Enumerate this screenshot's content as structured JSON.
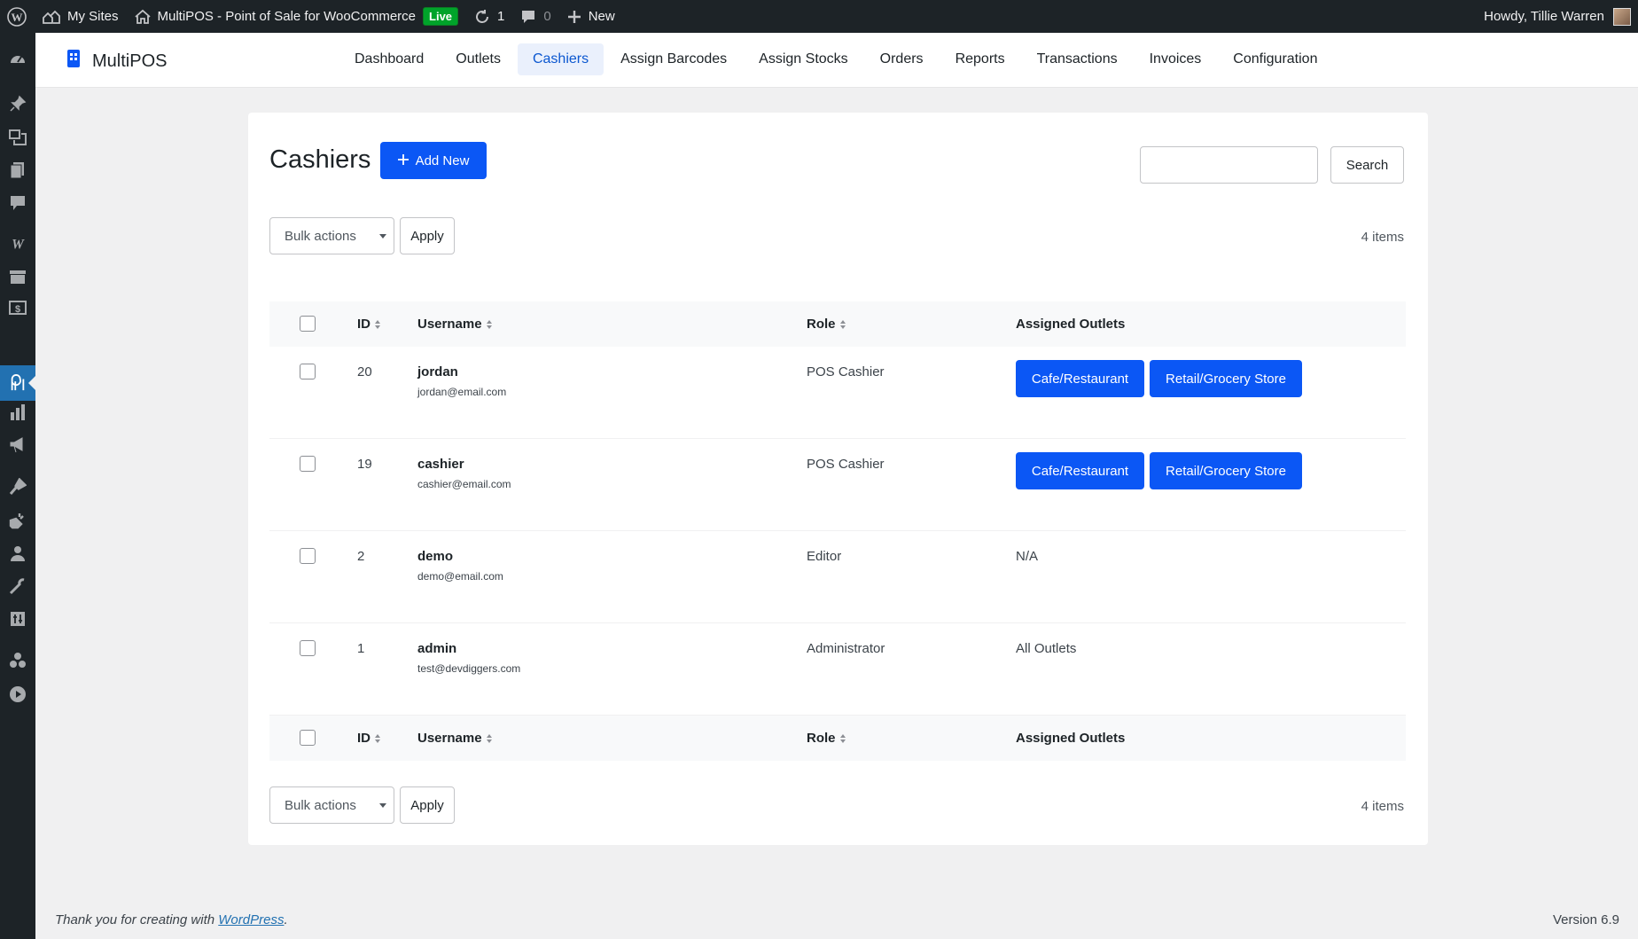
{
  "adminbar": {
    "my_sites": "My Sites",
    "site_name": "MultiPOS - Point of Sale for WooCommerce",
    "live_badge": "Live",
    "updates_count": "1",
    "comments_count": "0",
    "new_label": "New",
    "howdy": "Howdy, Tillie Warren"
  },
  "adminmenu": {
    "icons": [
      "dashboard-icon",
      "pin-icon",
      "media-icon",
      "pages-icon",
      "comments-icon",
      "woocommerce-icon",
      "products-icon",
      "payments-icon",
      "multipos-icon",
      "analytics-icon",
      "marketing-icon",
      "appearance-icon",
      "plugins-icon",
      "users-icon",
      "tools-icon",
      "settings-icon",
      "collaboration-icon",
      "video-icon"
    ]
  },
  "header": {
    "brand": "MultiPOS",
    "nav": [
      "Dashboard",
      "Outlets",
      "Cashiers",
      "Assign Barcodes",
      "Assign Stocks",
      "Orders",
      "Reports",
      "Transactions",
      "Invoices",
      "Configuration"
    ],
    "active_nav": "Cashiers"
  },
  "page": {
    "title": "Cashiers",
    "add_new": "Add New",
    "search_button": "Search",
    "search_value": "",
    "bulk_actions": "Bulk actions",
    "apply": "Apply",
    "items_count": "4 items"
  },
  "table": {
    "columns": {
      "id": "ID",
      "username": "Username",
      "role": "Role",
      "assigned_outlets": "Assigned Outlets"
    },
    "rows": [
      {
        "id": "20",
        "username": "jordan",
        "email": "jordan@email.com",
        "role": "POS Cashier",
        "outlets": [
          "Cafe/Restaurant",
          "Retail/Grocery Store"
        ],
        "outlets_text": ""
      },
      {
        "id": "19",
        "username": "cashier",
        "email": "cashier@email.com",
        "role": "POS Cashier",
        "outlets": [
          "Cafe/Restaurant",
          "Retail/Grocery Store"
        ],
        "outlets_text": ""
      },
      {
        "id": "2",
        "username": "demo",
        "email": "demo@email.com",
        "role": "Editor",
        "outlets": [],
        "outlets_text": "N/A"
      },
      {
        "id": "1",
        "username": "admin",
        "email": "test@devdiggers.com",
        "role": "Administrator",
        "outlets": [],
        "outlets_text": "All Outlets"
      }
    ]
  },
  "footer": {
    "thanks_prefix": "Thank you for creating with ",
    "wordpress_link": "WordPress",
    "thanks_suffix": ".",
    "version": "Version 6.9"
  },
  "colors": {
    "primary": "#0b57f5",
    "admin_bar": "#1d2327",
    "live": "#00a32a",
    "active_nav_bg": "#eaf0fc"
  }
}
